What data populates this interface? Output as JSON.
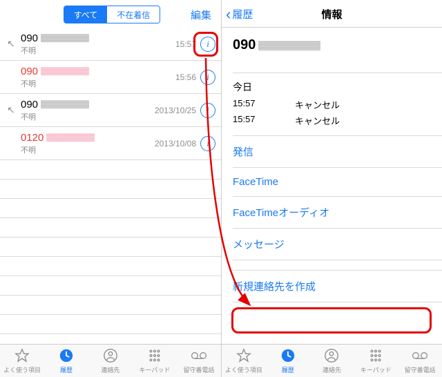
{
  "left": {
    "seg_all": "すべて",
    "seg_missed": "不在着信",
    "edit": "編集",
    "rows": [
      {
        "num": "090",
        "sub": "不明",
        "time": "15:57",
        "missed": false,
        "handset": true
      },
      {
        "num": "090",
        "sub": "不明",
        "time": "15:56",
        "missed": true,
        "handset": false
      },
      {
        "num": "090",
        "sub": "不明",
        "time": "2013/10/25",
        "missed": false,
        "handset": true
      },
      {
        "num": "0120",
        "sub": "不明",
        "time": "2013/10/08",
        "missed": true,
        "handset": false
      }
    ]
  },
  "right": {
    "back": "履歴",
    "title": "情報",
    "number": "090",
    "today": "今日",
    "log": [
      {
        "t": "15:57",
        "s": "キャンセル"
      },
      {
        "t": "15:57",
        "s": "キャンセル"
      }
    ],
    "actions": {
      "call": "発信",
      "facetime": "FaceTime",
      "facetime_audio": "FaceTimeオーディオ",
      "message": "メッセージ",
      "new_contact": "新規連絡先を作成"
    }
  },
  "tabs": {
    "fav": "よく使う項目",
    "recents": "履歴",
    "contacts": "連絡先",
    "keypad": "キーパッド",
    "voicemail": "留守番電話"
  }
}
